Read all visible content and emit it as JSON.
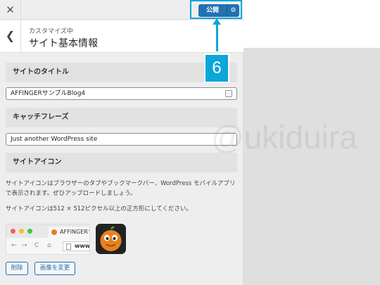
{
  "header": {
    "close_icon": "close-icon",
    "publish_label": "公開",
    "publish_settings_icon": "gear-icon"
  },
  "section": {
    "back_icon": "chevron-left-icon",
    "breadcrumb": "カスタマイズ中",
    "title": "サイト基本情報"
  },
  "site_title": {
    "label": "サイトのタイトル",
    "value": "AFFINGERサンプルBlog4"
  },
  "tagline": {
    "label": "キャッチフレーズ",
    "value": "Just another WordPress site"
  },
  "site_icon": {
    "label": "サイトアイコン",
    "description": "サイトアイコンはブラウザーのタブやブックマークバー、WordPress モバイルアプリで表示されます。ぜひアップロードしましょう。",
    "size_note": "サイトアイコンは512 × 512ピクセル以上の正方形にしてください。",
    "preview_tab_label": "AFFINGERサ",
    "preview_url": "www.",
    "remove_button": "削除",
    "change_button": "画像を変更"
  },
  "annotation": {
    "step_number": "6"
  },
  "watermark": "@ukiduira",
  "colors": {
    "accent": "#2271b1",
    "annotation": "#0aa7d8"
  }
}
